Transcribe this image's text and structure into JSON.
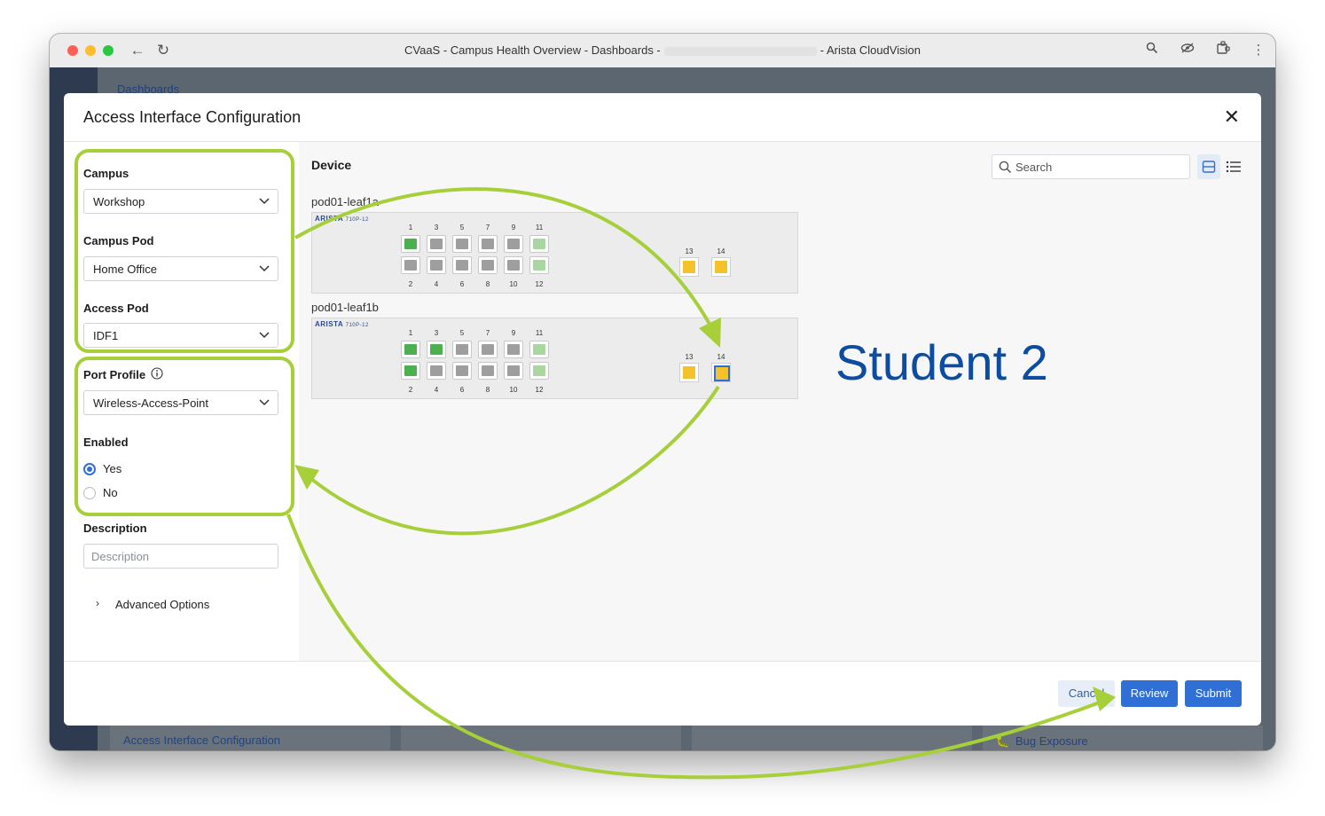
{
  "window": {
    "title_left": "CVaaS - Campus Health Overview - Dashboards -",
    "title_right": "- Arista CloudVision"
  },
  "dashboard": {
    "breadcrumb": "Dashboards",
    "panel_link_left": "Access Interface Configuration",
    "panel_link_right": "Bug Exposure"
  },
  "modal": {
    "title": "Access Interface Configuration",
    "campus_label": "Campus",
    "campus_value": "Workshop",
    "campus_pod_label": "Campus Pod",
    "campus_pod_value": "Home Office",
    "access_pod_label": "Access Pod",
    "access_pod_value": "IDF1",
    "port_profile_label": "Port Profile",
    "port_profile_value": "Wireless-Access-Point",
    "enabled_label": "Enabled",
    "enabled_yes": "Yes",
    "enabled_no": "No",
    "enabled_selected": "Yes",
    "description_label": "Description",
    "description_placeholder": "Description",
    "advanced_options": "Advanced Options",
    "cancel_label": "Cancel",
    "review_label": "Review",
    "submit_label": "Submit"
  },
  "device_panel": {
    "title": "Device",
    "search_placeholder": "Search",
    "switches": [
      {
        "name": "pod01-leaf1a",
        "brand": "ARISTA",
        "model": "710P-12",
        "port_numbers_top": [
          "1",
          "3",
          "5",
          "7",
          "9",
          "11"
        ],
        "port_numbers_bottom": [
          "2",
          "4",
          "6",
          "8",
          "10",
          "12"
        ],
        "ports_top_status": [
          "up",
          "down",
          "down",
          "down",
          "down",
          "poe-idle"
        ],
        "ports_bottom_status": [
          "down",
          "down",
          "down",
          "down",
          "down",
          "poe-idle"
        ],
        "uplinks": [
          "13",
          "14"
        ],
        "selected_uplink": ""
      },
      {
        "name": "pod01-leaf1b",
        "brand": "ARISTA",
        "model": "710P-12",
        "port_numbers_top": [
          "1",
          "3",
          "5",
          "7",
          "9",
          "11"
        ],
        "port_numbers_bottom": [
          "2",
          "4",
          "6",
          "8",
          "10",
          "12"
        ],
        "ports_top_status": [
          "up",
          "up",
          "down",
          "down",
          "down",
          "poe-idle"
        ],
        "ports_bottom_status": [
          "up",
          "down",
          "down",
          "down",
          "down",
          "poe-idle"
        ],
        "uplinks": [
          "13",
          "14"
        ],
        "selected_uplink": "14"
      }
    ]
  },
  "annotation": {
    "text": "Student 2",
    "text_color": "#0c4da2",
    "arrow_color": "#a6cf3a",
    "highlight_color": "#a6cf3a"
  },
  "colors": {
    "accent": "#2f6fd6",
    "port_up": "#4caf50",
    "port_down": "#9e9e9e",
    "port_poe_idle": "#a8d8a0",
    "sfp": "#f4c22b"
  }
}
